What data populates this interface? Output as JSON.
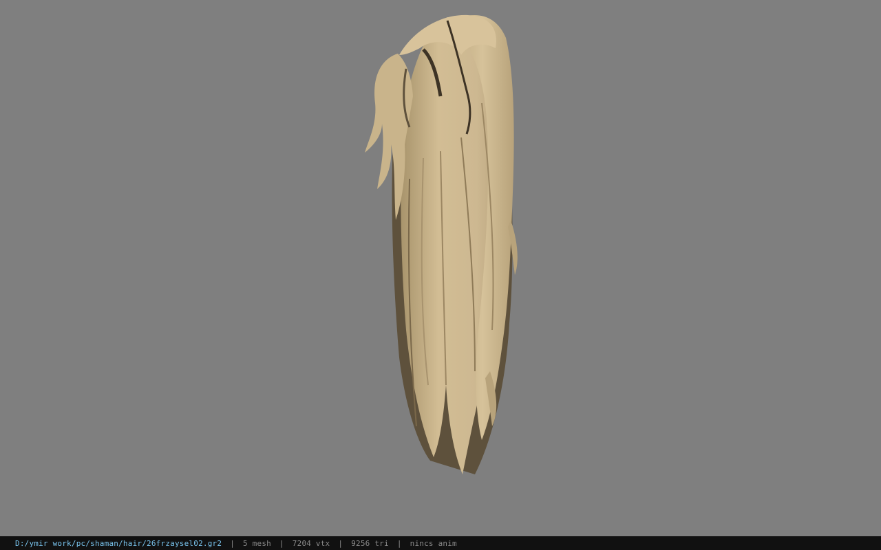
{
  "viewer": {
    "background_color": "#7f7f7f",
    "model_color": "#cdb891",
    "model_shadow_color": "#5e513c",
    "model_dark_color": "#3d3325"
  },
  "status_bar": {
    "file_path": "D:/ymir work/pc/shaman/hair/26frzaysel02.gr2",
    "separator": "|",
    "mesh_count": "5 mesh",
    "vertex_count": "7204 vtx",
    "triangle_count": "9256 tri",
    "anim_status": "nincs anim",
    "path_color": "#79c4ee",
    "text_color": "#8a8a8a",
    "bar_color": "#111111"
  }
}
